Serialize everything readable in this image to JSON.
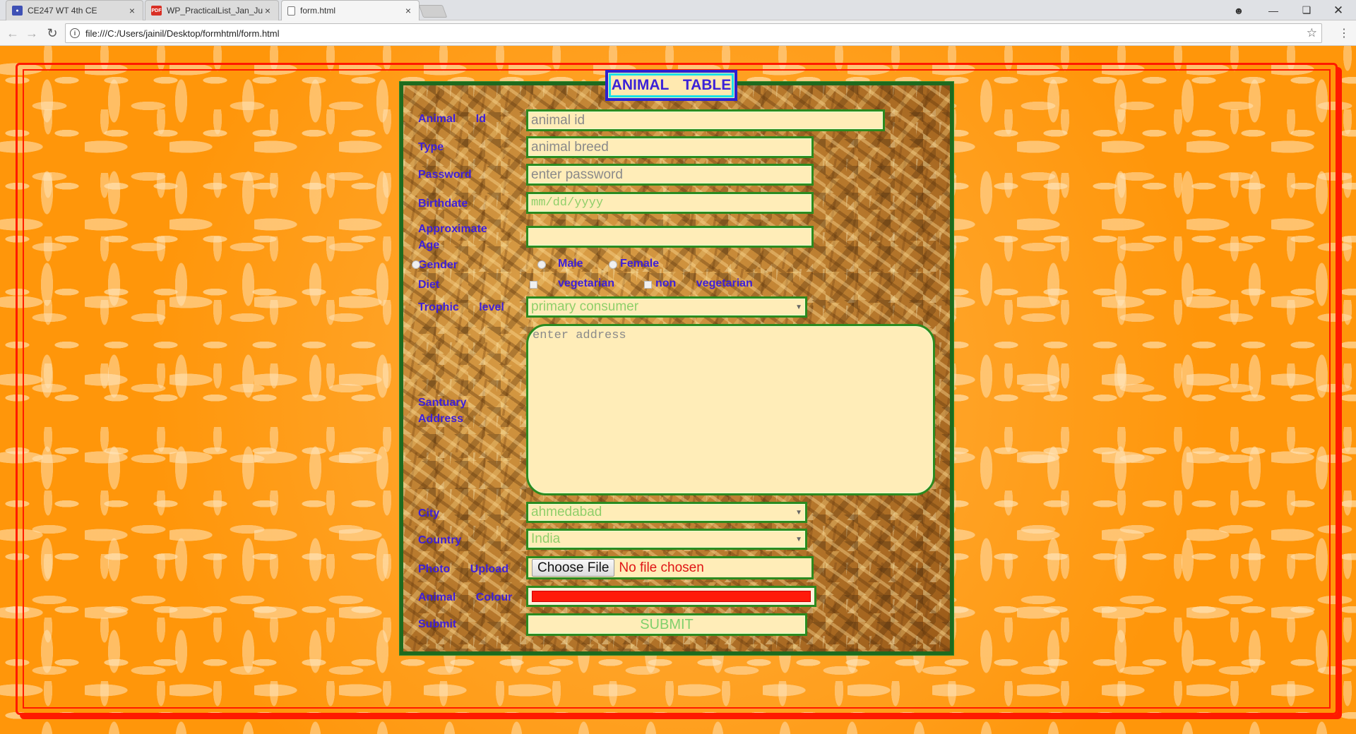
{
  "browser": {
    "tabs": [
      {
        "title": "CE247 WT 4th CE",
        "icon": "classroom-icon"
      },
      {
        "title": "WP_PracticalList_Jan_Jun",
        "icon": "pdf-icon"
      },
      {
        "title": "form.html",
        "icon": "document-icon"
      }
    ],
    "url": "file:///C:/Users/jainil/Desktop/formhtml/form.html",
    "pdf_badge": "PDF"
  },
  "form": {
    "caption": "ANIMAL TABLE",
    "labels": {
      "animal_id": "Animal Id",
      "type": "Type",
      "password": "Password",
      "birthdate": "Birthdate",
      "approx_age_1": "Approximate",
      "approx_age_2": "Age",
      "gender": "Gender",
      "diet": "Diet",
      "trophic": "Trophic level",
      "address_1": "Santuary",
      "address_2": "Address",
      "city": "City",
      "country": "Country",
      "photo": "Photo Upload",
      "colour": "Animal Colour",
      "submit": "Submit"
    },
    "placeholders": {
      "animal_id": "animal id",
      "type": "animal breed",
      "password": "enter password",
      "birthdate": "mm/dd/yyyy",
      "address": "enter address"
    },
    "gender_options": [
      "Male",
      "Female"
    ],
    "diet_options": [
      "vegetarian",
      "non vegetarian"
    ],
    "trophic_selected": "primary consumer",
    "city_selected": "ahmedabad",
    "country_selected": "India",
    "file_button": "Choose File",
    "file_status": "No file chosen",
    "colour_value": "#ff1a0a",
    "submit_button": "SUBMIT"
  }
}
